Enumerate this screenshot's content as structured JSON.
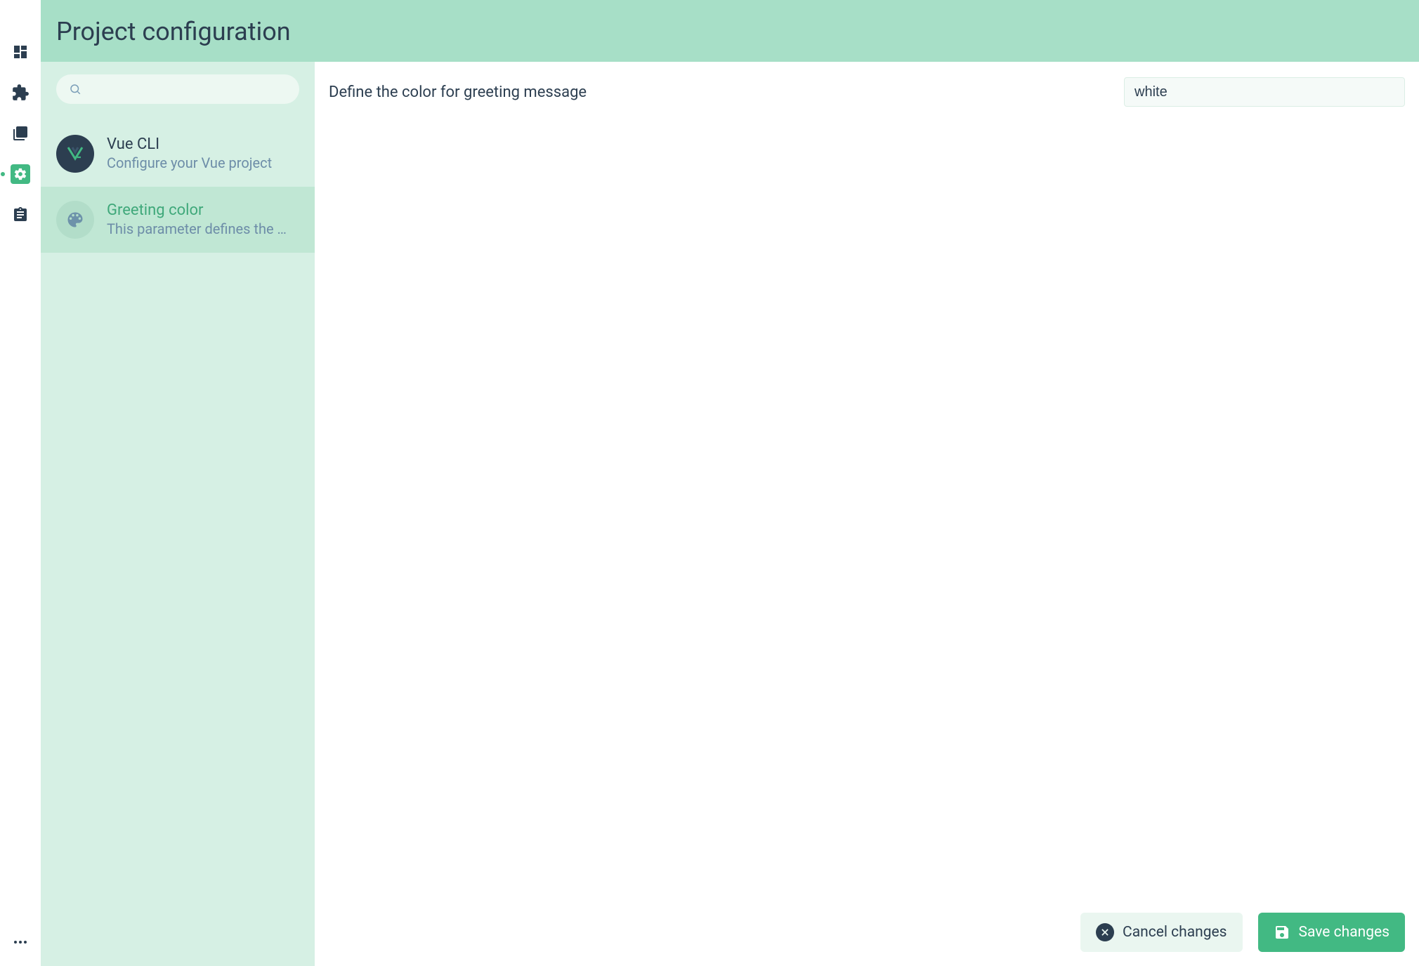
{
  "rail": {
    "items": [
      {
        "name": "dashboard",
        "icon": "dashboard"
      },
      {
        "name": "plugins",
        "icon": "extension"
      },
      {
        "name": "dependencies",
        "icon": "collections"
      },
      {
        "name": "configuration",
        "icon": "settings",
        "active": true
      },
      {
        "name": "tasks",
        "icon": "assignment"
      }
    ],
    "more": {
      "icon": "more"
    }
  },
  "header": {
    "title": "Project configuration"
  },
  "sidebar": {
    "search": {
      "placeholder": ""
    },
    "items": [
      {
        "id": "vue-cli",
        "title": "Vue CLI",
        "description": "Configure your Vue project",
        "icon": "vue",
        "selected": false
      },
      {
        "id": "greeting-color",
        "title": "Greeting color",
        "description": "This parameter defines the …",
        "icon": "palette",
        "selected": true
      }
    ]
  },
  "content": {
    "field": {
      "label": "Define the color for greeting message",
      "value": "white"
    }
  },
  "actions": {
    "cancel_label": "Cancel changes",
    "save_label": "Save changes"
  },
  "colors": {
    "brand": "#42b983",
    "header_bg": "#a7dfc7",
    "sidebar_bg": "#d6f0e4",
    "selected_bg": "#c0e7d4",
    "text": "#2c3e50"
  }
}
